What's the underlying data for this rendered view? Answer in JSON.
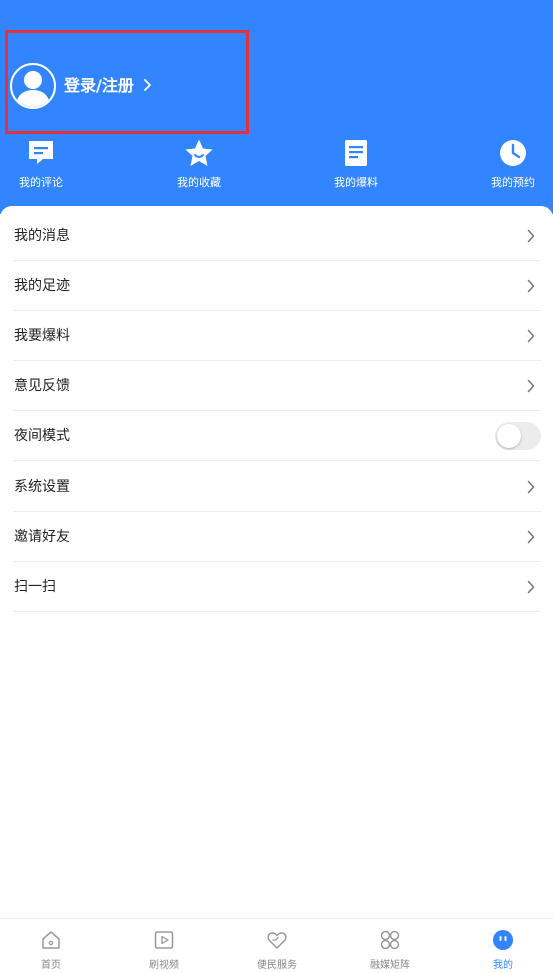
{
  "colors": {
    "primary": "#3385ff",
    "highlight_border": "#e0333f",
    "text": "#222222",
    "muted": "#888888"
  },
  "header": {
    "login_label": "登录/注册",
    "avatar_icon": "user-avatar-icon",
    "quick_actions": [
      {
        "label": "我的评论",
        "icon": "comment-icon"
      },
      {
        "label": "我的收藏",
        "icon": "star-icon"
      },
      {
        "label": "我的爆料",
        "icon": "document-icon"
      },
      {
        "label": "我的预约",
        "icon": "clock-icon"
      }
    ]
  },
  "menu": [
    {
      "label": "我的消息",
      "control": "chevron"
    },
    {
      "label": "我的足迹",
      "control": "chevron"
    },
    {
      "label": "我要爆料",
      "control": "chevron"
    },
    {
      "label": "意见反馈",
      "control": "chevron"
    },
    {
      "label": "夜间模式",
      "control": "toggle",
      "enabled": false
    },
    {
      "label": "系统设置",
      "control": "chevron"
    },
    {
      "label": "邀请好友",
      "control": "chevron"
    },
    {
      "label": "扫一扫",
      "control": "chevron"
    }
  ],
  "tabbar": [
    {
      "label": "首页",
      "icon": "home-icon",
      "active": false
    },
    {
      "label": "刷视频",
      "icon": "video-play-icon",
      "active": false
    },
    {
      "label": "便民服务",
      "icon": "heart-service-icon",
      "active": false
    },
    {
      "label": "融媒矩阵",
      "icon": "grid-cluster-icon",
      "active": false
    },
    {
      "label": "我的",
      "icon": "profile-face-icon",
      "active": true
    }
  ]
}
